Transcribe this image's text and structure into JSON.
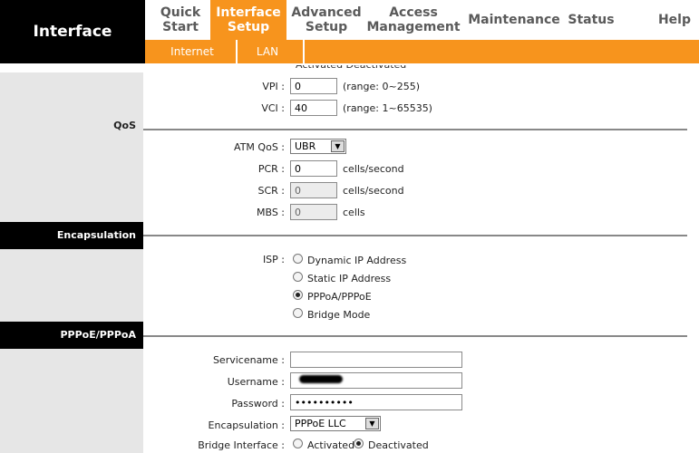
{
  "brand": "Interface",
  "nav": {
    "tabs": [
      {
        "label": "Quick\nStart"
      },
      {
        "label": "Interface\nSetup"
      },
      {
        "label": "Advanced\nSetup"
      },
      {
        "label": "Access\nManagement"
      },
      {
        "label": "Maintenance"
      },
      {
        "label": "Status"
      },
      {
        "label": "Help"
      }
    ],
    "active_index": 1,
    "subtabs": [
      "Internet",
      "LAN"
    ]
  },
  "top_partial": "Activated  Deactivated",
  "vc": {
    "vpi_label": "VPI :",
    "vpi_value": "0",
    "vpi_range": "(range: 0~255)",
    "vci_label": "VCI :",
    "vci_value": "40",
    "vci_range": "(range: 1~65535)"
  },
  "qos": {
    "title": "QoS",
    "atm_label": "ATM QoS :",
    "atm_value": "UBR",
    "pcr_label": "PCR :",
    "pcr_value": "0",
    "pcr_unit": "cells/second",
    "scr_label": "SCR :",
    "scr_value": "0",
    "scr_unit": "cells/second",
    "mbs_label": "MBS :",
    "mbs_value": "0",
    "mbs_unit": "cells"
  },
  "encapsulation": {
    "title": "Encapsulation",
    "isp_label": "ISP :",
    "options": [
      "Dynamic IP Address",
      "Static IP Address",
      "PPPoA/PPPoE",
      "Bridge Mode"
    ],
    "selected_index": 2
  },
  "pppoe": {
    "title": "PPPoE/PPPoA",
    "servicename_label": "Servicename :",
    "servicename_value": "",
    "username_label": "Username :",
    "password_label": "Password :",
    "password_value": "••••••••••",
    "encap_label": "Encapsulation :",
    "encap_value": "PPPoE LLC",
    "bridge_label": "Bridge Interface :",
    "bridge_on": "Activated",
    "bridge_off": "Deactivated",
    "bridge_selected": "Deactivated"
  },
  "colors": {
    "accent": "#f7941d",
    "header_bg": "#000000",
    "side_bg": "#e6e6e6"
  }
}
